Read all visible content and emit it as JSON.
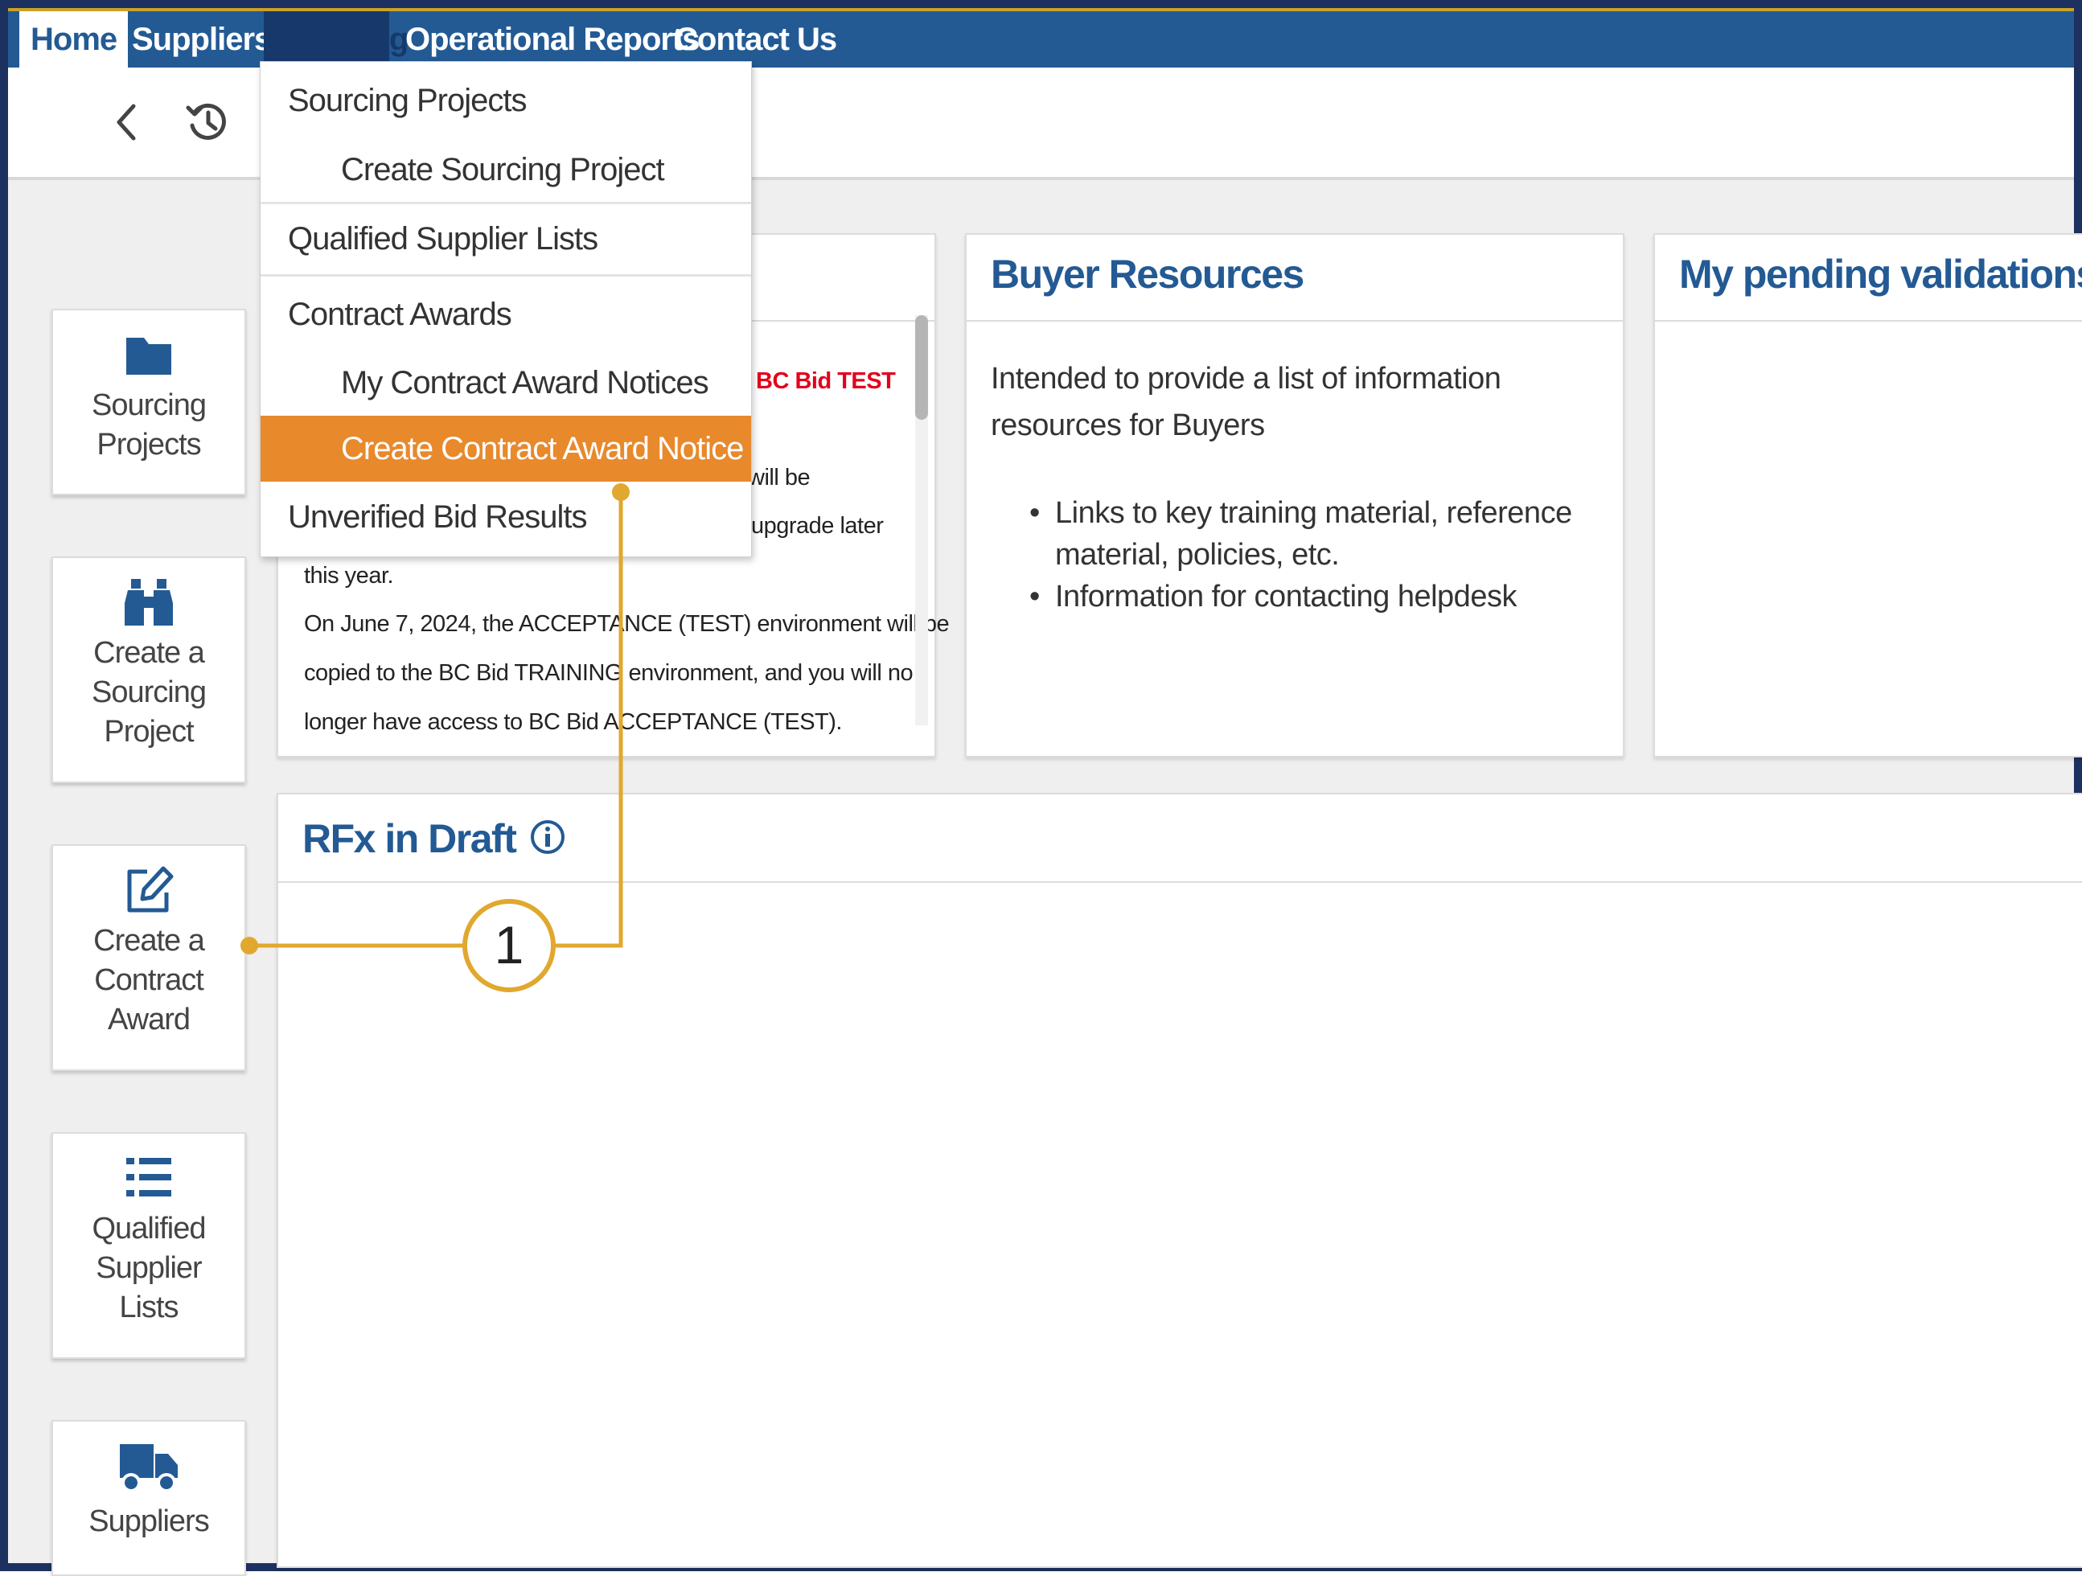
{
  "nav": {
    "home": "Home",
    "suppliers": "Suppliers",
    "sourcing": "Sourcing",
    "operational_reports": "Operational Reports",
    "contact_us": "Contact Us"
  },
  "toolbar": {
    "back_icon": "chevron-left-icon",
    "history_icon": "history-icon"
  },
  "sidebar": {
    "items": [
      {
        "label": "Sourcing\nProjects",
        "icon": "folder-icon"
      },
      {
        "label": "Create a\nSourcing\nProject",
        "icon": "binoculars-icon"
      },
      {
        "label": "Create a\nContract\nAward",
        "icon": "edit-icon"
      },
      {
        "label": "Qualified\nSupplier\nLists",
        "icon": "list-icon"
      },
      {
        "label": "Suppliers",
        "icon": "truck-icon"
      }
    ]
  },
  "news_panel": {
    "alert_text": "BC Bid TEST",
    "lines": [
      "will be",
      "upgrade later",
      "this year.",
      "On June 7, 2024, the ACCEPTANCE (TEST) environment will be",
      "copied to the BC Bid TRAINING environment, and you will no",
      "longer have access to BC Bid ACCEPTANCE (TEST)."
    ]
  },
  "buyer_resources": {
    "title": "Buyer Resources",
    "description": "Intended to provide a list of information resources for Buyers",
    "bullets": [
      "Links to key training material, reference material, policies, etc.",
      "Information for contacting helpdesk"
    ]
  },
  "pending": {
    "title": "My pending validations"
  },
  "rfx": {
    "title": "RFx in Draft",
    "info_icon": "info-icon"
  },
  "dropdown": {
    "sourcing_projects": "Sourcing Projects",
    "create_sourcing_project": "Create Sourcing Project",
    "qualified_supplier_lists": "Qualified Supplier Lists",
    "contract_awards": "Contract Awards",
    "my_contract_award_notices": "My Contract Award Notices",
    "create_contract_award_notice": "Create Contract Award Notice",
    "unverified_bid_results": "Unverified Bid Results"
  },
  "callout": {
    "number": "1"
  },
  "colors": {
    "nav_blue": "#235a94",
    "active_orange": "#e8892c",
    "callout_gold": "#e0a82e",
    "frame_navy": "#1d3160",
    "alert_red": "#e3001b"
  }
}
